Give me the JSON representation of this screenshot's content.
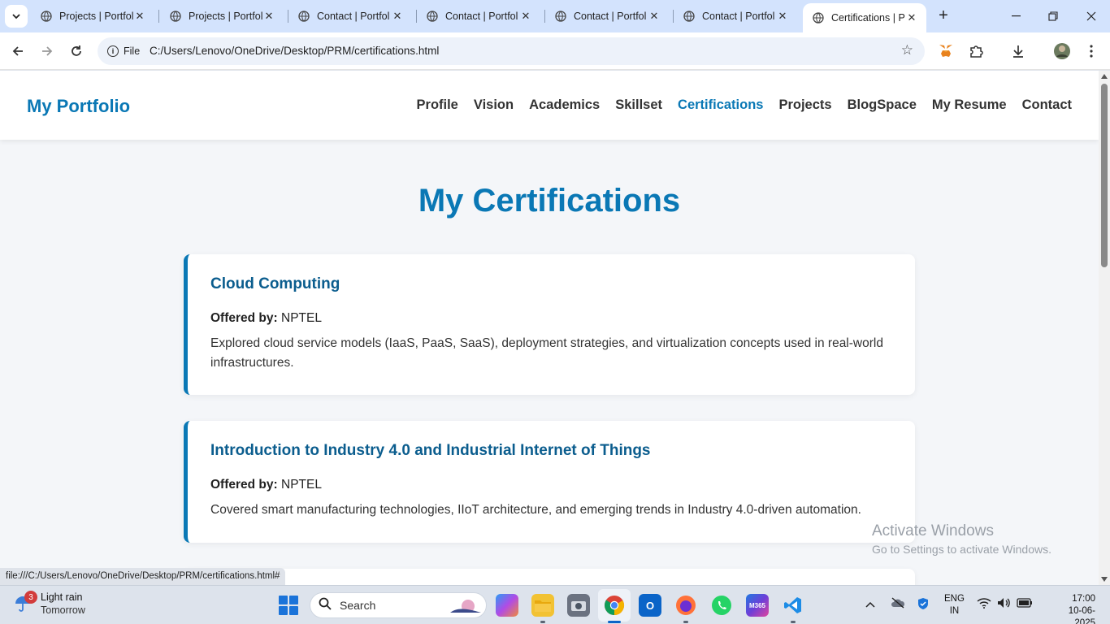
{
  "browser": {
    "tabs": [
      {
        "title": "Projects | Portfol",
        "active": false
      },
      {
        "title": "Projects | Portfol",
        "active": false
      },
      {
        "title": "Contact | Portfol",
        "active": false
      },
      {
        "title": "Contact | Portfol",
        "active": false
      },
      {
        "title": "Contact | Portfol",
        "active": false
      },
      {
        "title": "Contact | Portfol",
        "active": false
      },
      {
        "title": "Certifications | P",
        "active": true
      }
    ],
    "scheme_label": "File",
    "url": "C:/Users/Lenovo/OneDrive/Desktop/PRM/certifications.html",
    "status_url": "file:///C:/Users/Lenovo/OneDrive/Desktop/PRM/certifications.html#"
  },
  "site": {
    "brand": "My Portfolio",
    "nav": [
      {
        "label": "Profile",
        "current": false
      },
      {
        "label": "Vision",
        "current": false
      },
      {
        "label": "Academics",
        "current": false
      },
      {
        "label": "Skillset",
        "current": false
      },
      {
        "label": "Certifications",
        "current": true
      },
      {
        "label": "Projects",
        "current": false
      },
      {
        "label": "BlogSpace",
        "current": false
      },
      {
        "label": "My Resume",
        "current": false
      },
      {
        "label": "Contact",
        "current": false
      }
    ],
    "page_title": "My Certifications",
    "offered_label": "Offered by:",
    "certifications": [
      {
        "title": "Cloud Computing",
        "provider": "NPTEL",
        "description": "Explored cloud service models (IaaS, PaaS, SaaS), deployment strategies, and virtualization concepts used in real-world infrastructures."
      },
      {
        "title": "Introduction to Industry 4.0 and Industrial Internet of Things",
        "provider": "NPTEL",
        "description": "Covered smart manufacturing technologies, IIoT architecture, and emerging trends in Industry 4.0-driven automation."
      }
    ],
    "accent_color": "#0a78b5"
  },
  "watermark": {
    "line1": "Activate Windows",
    "line2": "Go to Settings to activate Windows."
  },
  "taskbar": {
    "weather": {
      "badge": "3",
      "condition": "Light rain",
      "when": "Tomorrow"
    },
    "search_label": "Search",
    "lang_line1": "ENG",
    "lang_line2": "IN",
    "time": "17:00",
    "date": "10-06-2025"
  }
}
